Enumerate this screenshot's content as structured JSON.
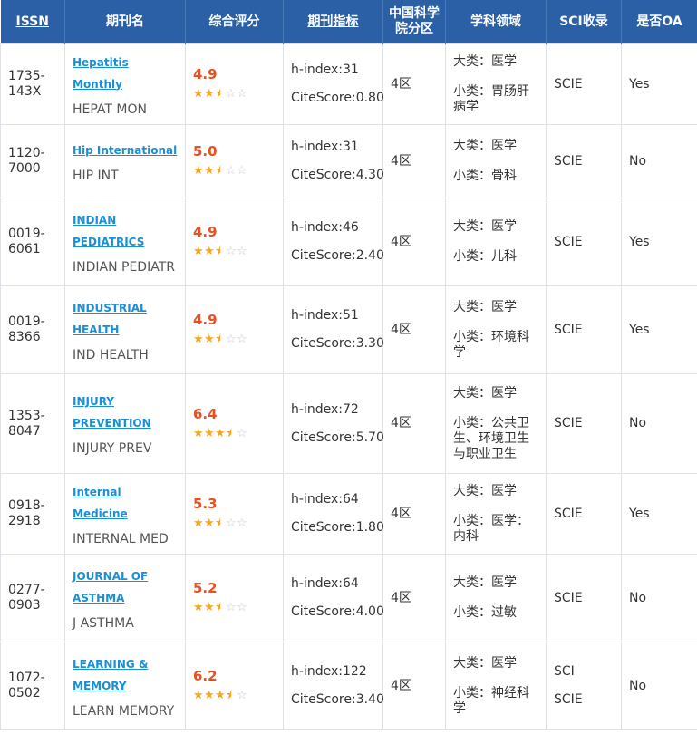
{
  "headers": {
    "issn": "ISSN",
    "name": "期刊名",
    "score": "综合评分",
    "metrics": "期刊指标",
    "cas_line1": "中国科学",
    "cas_line2": "院分区",
    "field": "学科领域",
    "sci": "SCI收录",
    "oa": "是否OA"
  },
  "colors": {
    "header_bg": "#2b5fa6",
    "link": "#1a8fd6",
    "score": "#e8501f",
    "star": "#f5a623"
  },
  "rows": [
    {
      "issn": "1735-143X",
      "link_lines": [
        "Hepatitis Monthly"
      ],
      "abbr": "HEPAT MON",
      "score": "4.9",
      "stars": 2.5,
      "h_index": "h-index:31",
      "citescore": "CiteScore:0.80",
      "cas": "4区",
      "big": "大类：医学",
      "small": "小类：胃肠肝病学",
      "sci": [
        "SCIE"
      ],
      "oa": "Yes"
    },
    {
      "issn": "1120-7000",
      "link_lines": [
        "Hip International"
      ],
      "abbr": "HIP INT",
      "score": "5.0",
      "stars": 2.5,
      "h_index": "h-index:31",
      "citescore": "CiteScore:4.30",
      "cas": "4区",
      "big": "大类：医学",
      "small": "小类：骨科",
      "sci": [
        "SCIE"
      ],
      "oa": "No"
    },
    {
      "issn": "0019-6061",
      "link_lines": [
        "INDIAN",
        "PEDIATRICS"
      ],
      "abbr": "INDIAN PEDIATR",
      "score": "4.9",
      "stars": 2.5,
      "h_index": "h-index:46",
      "citescore": "CiteScore:2.40",
      "cas": "4区",
      "big": "大类：医学",
      "small": "小类：儿科",
      "sci": [
        "SCIE"
      ],
      "oa": "Yes"
    },
    {
      "issn": "0019-8366",
      "link_lines": [
        "INDUSTRIAL",
        "HEALTH"
      ],
      "abbr": "IND HEALTH",
      "score": "4.9",
      "stars": 2.5,
      "h_index": "h-index:51",
      "citescore": "CiteScore:3.30",
      "cas": "4区",
      "big": "大类：医学",
      "small": "小类：环境科学",
      "sci": [
        "SCIE"
      ],
      "oa": "Yes"
    },
    {
      "issn": "1353-8047",
      "link_lines": [
        "INJURY",
        "PREVENTION"
      ],
      "abbr": "INJURY PREV",
      "score": "6.4",
      "stars": 3.5,
      "h_index": "h-index:72",
      "citescore": "CiteScore:5.70",
      "cas": "4区",
      "big": "大类：医学",
      "small": "小类：公共卫生、环境卫生与职业卫生",
      "sci": [
        "SCIE"
      ],
      "oa": "No"
    },
    {
      "issn": "0918-2918",
      "link_lines": [
        "Internal Medicine"
      ],
      "abbr": "INTERNAL MED",
      "score": "5.3",
      "stars": 2.5,
      "h_index": "h-index:64",
      "citescore": "CiteScore:1.80",
      "cas": "4区",
      "big": "大类：医学",
      "small": "小类：医学：内科",
      "sci": [
        "SCIE"
      ],
      "oa": "Yes"
    },
    {
      "issn": "0277-0903",
      "link_lines": [
        "JOURNAL OF",
        "ASTHMA"
      ],
      "abbr": "J ASTHMA",
      "score": "5.2",
      "stars": 2.5,
      "h_index": "h-index:64",
      "citescore": "CiteScore:4.00",
      "cas": "4区",
      "big": "大类：医学",
      "small": "小类：过敏",
      "sci": [
        "SCIE"
      ],
      "oa": "No"
    },
    {
      "issn": "1072-0502",
      "link_lines": [
        "LEARNING &",
        "MEMORY"
      ],
      "abbr": "LEARN MEMORY",
      "score": "6.2",
      "stars": 3.5,
      "h_index": "h-index:122",
      "citescore": "CiteScore:3.40",
      "cas": "4区",
      "big": "大类：医学",
      "small": "小类：神经科学",
      "sci": [
        "SCI",
        "SCIE"
      ],
      "oa": "No"
    }
  ]
}
